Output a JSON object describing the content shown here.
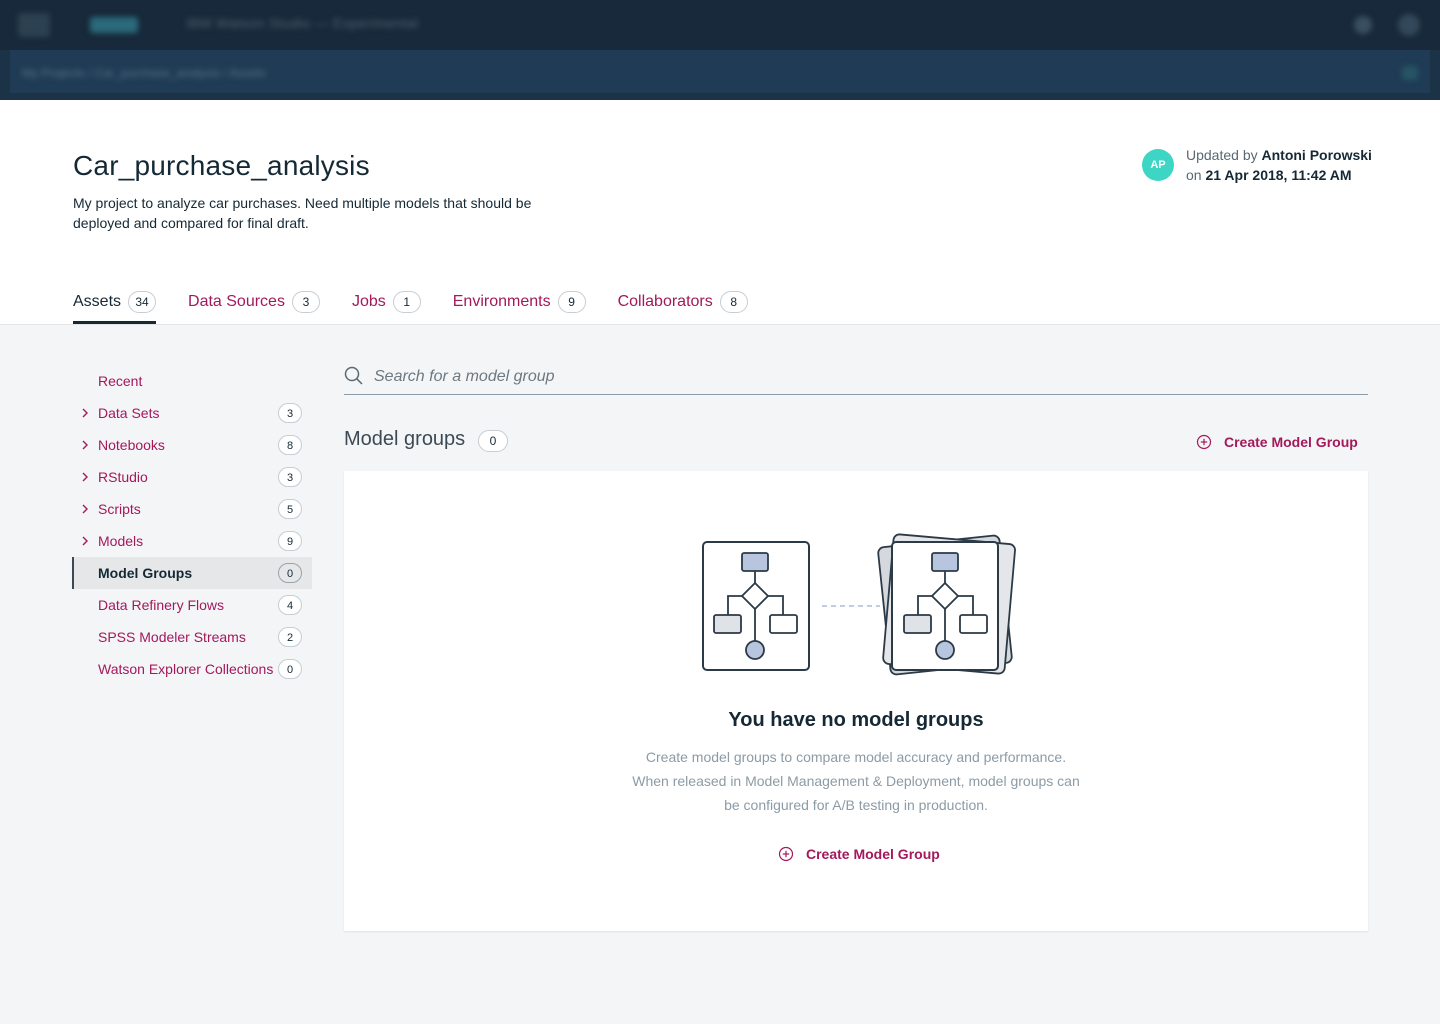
{
  "topbar": {
    "title": "IBM Watson Studio — Experimental"
  },
  "subbar": {
    "breadcrumbs": "My Projects  /  Car_purchase_analysis  /  Assets"
  },
  "project": {
    "title": "Car_purchase_analysis",
    "description": "My project to analyze car purchases. Need multiple models that should be deployed and compared for final draft.",
    "avatar_initials": "AP",
    "avatar_color": "#3dd6c5",
    "updated_prefix": "Updated by",
    "updated_by": "Antoni Porowski",
    "updated_on_prefix": "on",
    "updated_on": "21 Apr 2018, 11:42 AM"
  },
  "tabs": [
    {
      "label": "Assets",
      "count": "34",
      "active": true
    },
    {
      "label": "Data Sources",
      "count": "3",
      "active": false
    },
    {
      "label": "Jobs",
      "count": "1",
      "active": false
    },
    {
      "label": "Environments",
      "count": "9",
      "active": false
    },
    {
      "label": "Collaborators",
      "count": "8",
      "active": false
    }
  ],
  "sidebar": {
    "items": [
      {
        "label": "Recent",
        "count": "",
        "expandable": false,
        "selected": false
      },
      {
        "label": "Data Sets",
        "count": "3",
        "expandable": true,
        "selected": false
      },
      {
        "label": "Notebooks",
        "count": "8",
        "expandable": true,
        "selected": false
      },
      {
        "label": "RStudio",
        "count": "3",
        "expandable": true,
        "selected": false
      },
      {
        "label": "Scripts",
        "count": "5",
        "expandable": true,
        "selected": false
      },
      {
        "label": "Models",
        "count": "9",
        "expandable": true,
        "selected": false
      },
      {
        "label": "Model Groups",
        "count": "0",
        "expandable": false,
        "selected": true
      },
      {
        "label": "Data Refinery Flows",
        "count": "4",
        "expandable": false,
        "selected": false
      },
      {
        "label": "SPSS Modeler Streams",
        "count": "2",
        "expandable": false,
        "selected": false
      },
      {
        "label": "Watson Explorer Collections",
        "count": "0",
        "expandable": false,
        "selected": false
      }
    ]
  },
  "search": {
    "placeholder": "Search for a model group",
    "value": ""
  },
  "section": {
    "title": "Model groups",
    "count": "0",
    "create_label": "Create Model Group"
  },
  "empty_state": {
    "title": "You have no model groups",
    "description": "Create model groups to compare model accuracy and performance. When released in Model Management & Deployment, model groups can be configured for A/B testing in production.",
    "create_label": "Create Model Group"
  },
  "colors": {
    "accent": "#a3195b",
    "text": "#152935",
    "topbar": "#17293a"
  }
}
